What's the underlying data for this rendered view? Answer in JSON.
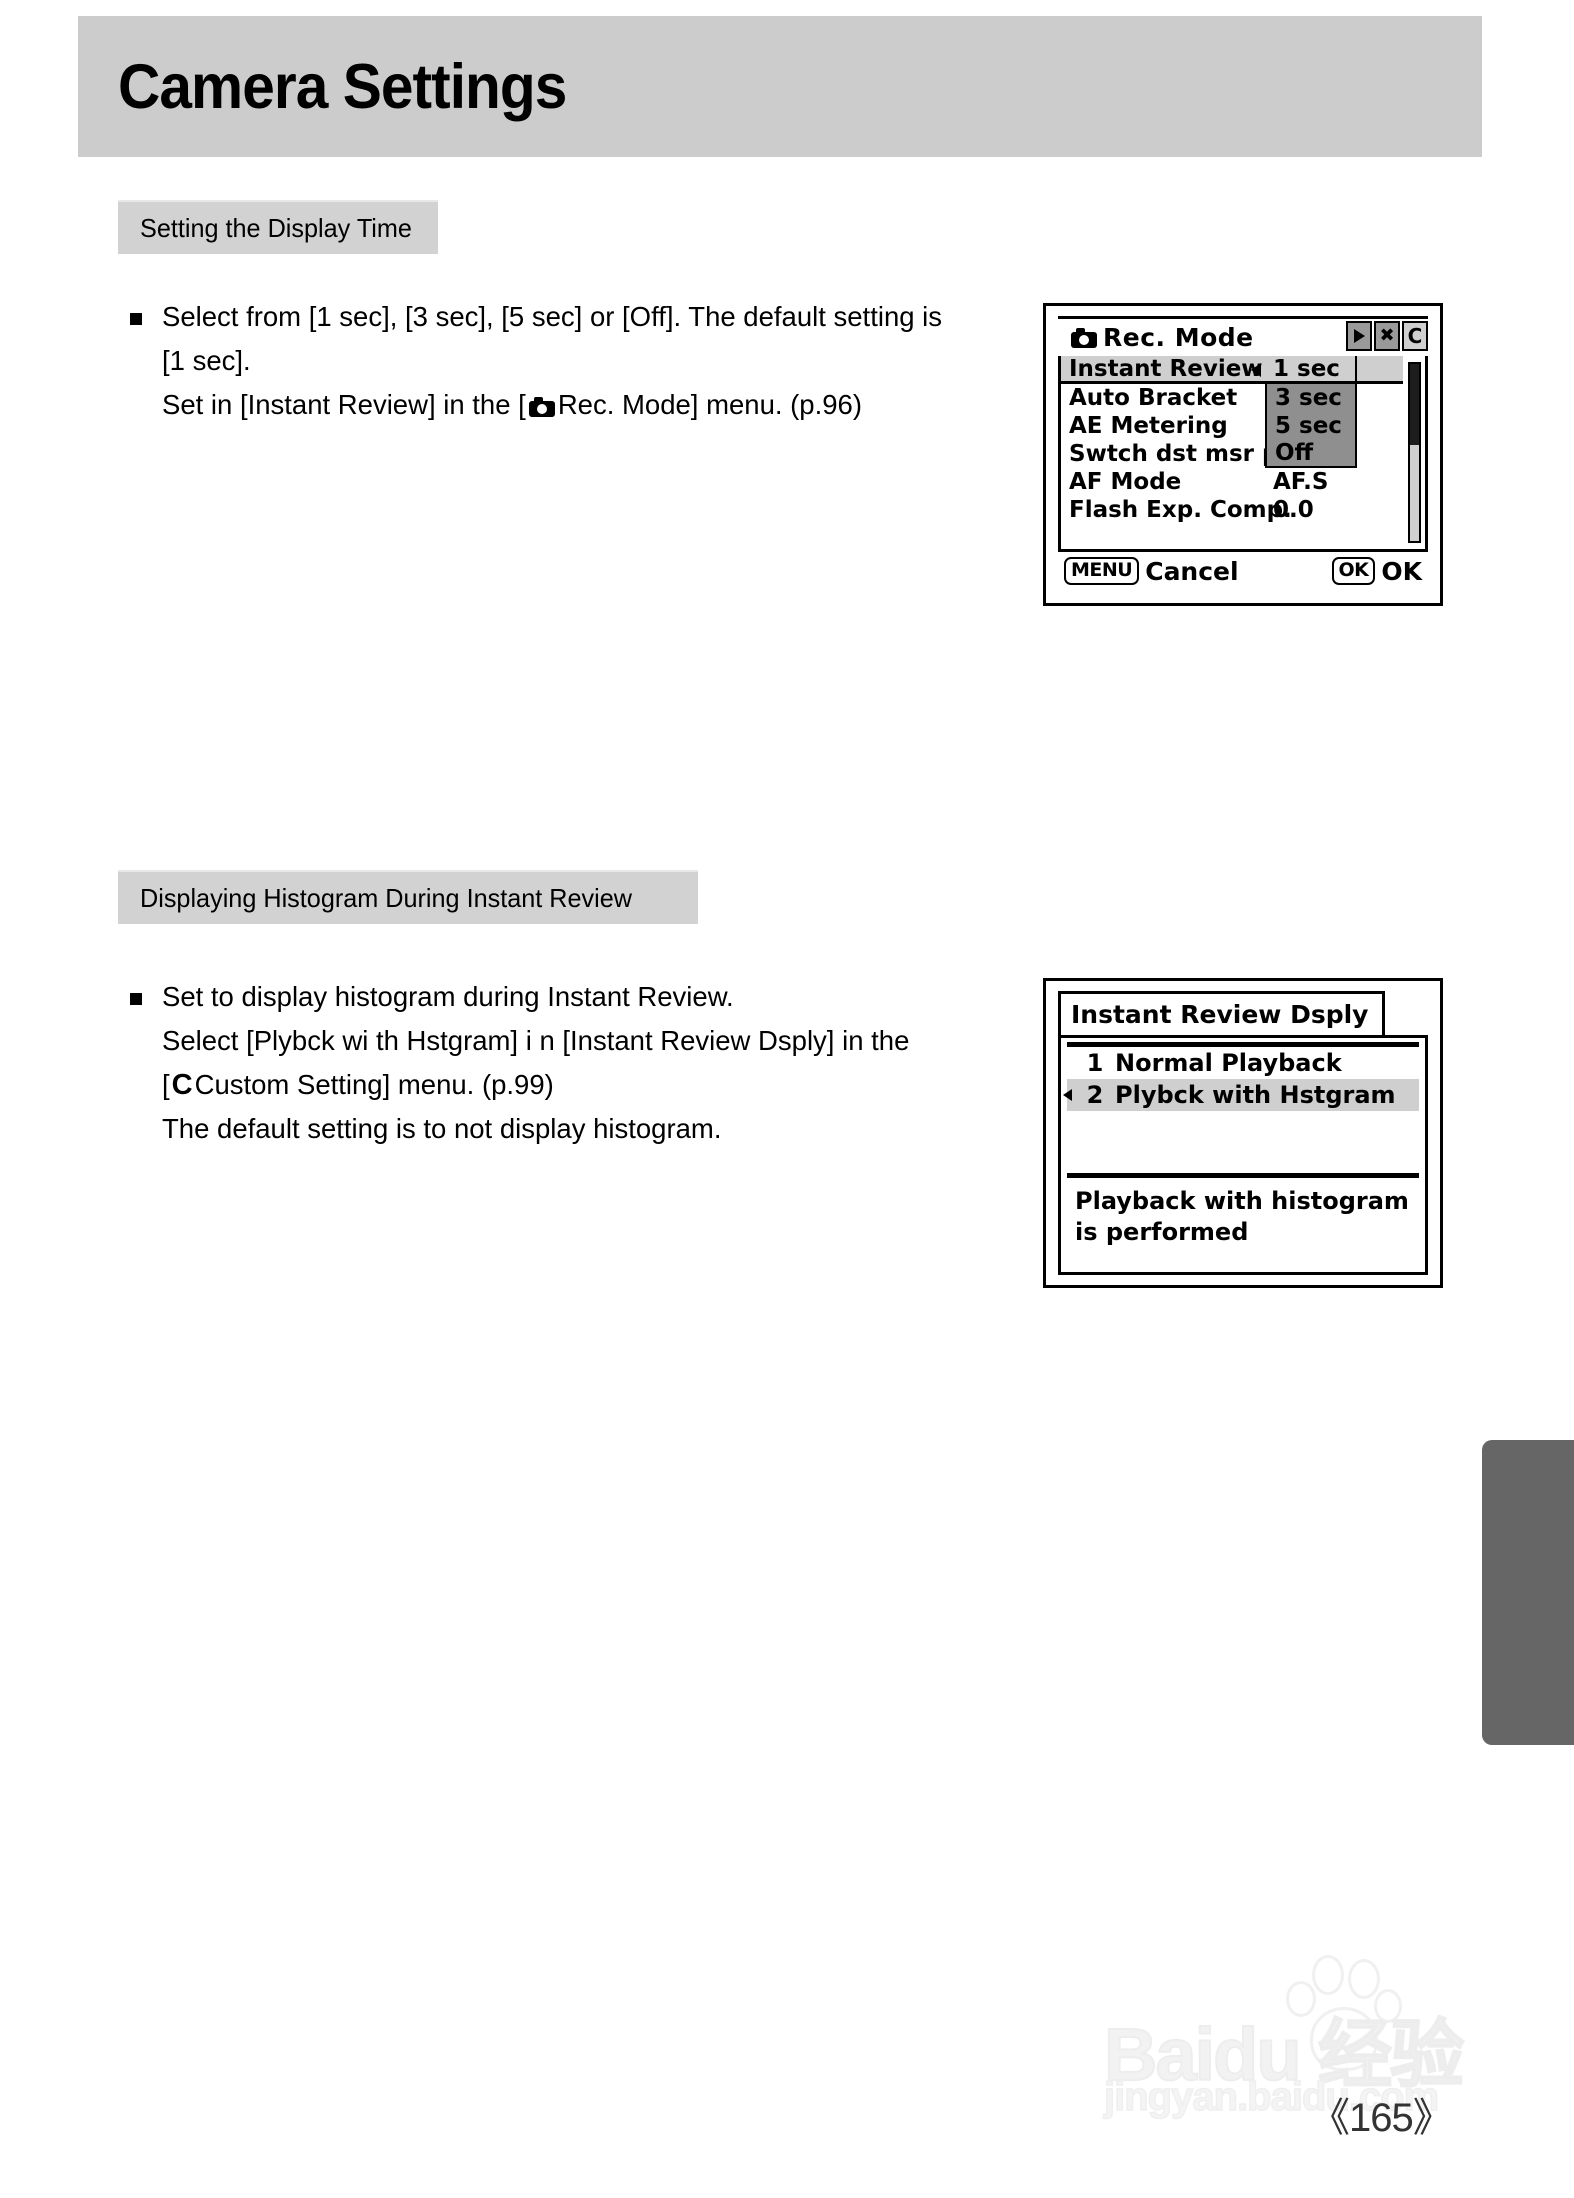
{
  "page": {
    "title": "Camera Settings",
    "page_number": "《165》"
  },
  "watermark": {
    "brand": "Baidu 经验",
    "url": "jingyan.baidu.com"
  },
  "sections": [
    {
      "heading": "Setting the Display Time",
      "body": {
        "line1": "Select from [1 sec], [3 sec], [5 sec] or [Off]. The default setting is",
        "line2": "[1 sec].",
        "line3_a": "Set in [Instant Review] in the [",
        "line3_icon": "camera-icon",
        "line3_b": "Rec. Mode] menu. (p.96)"
      }
    },
    {
      "heading": "Displaying Histogram During Instant Review",
      "body": {
        "line1": "Set to display histogram during Instant Review.",
        "line2": "Select [Plybck wi th Hstgram] i n [Instant Review Dsply] in the",
        "line3_a": "[",
        "line3_icon": "C",
        "line3_b": "Custom Setting] menu. (p.99)",
        "line4": "The default setting is to not display histogram."
      }
    }
  ],
  "lcd_rec_mode": {
    "title": "Rec. Mode",
    "title_icon": "camera-icon",
    "tabs": [
      {
        "name": "playback-tab",
        "glyph": "▶",
        "active": false
      },
      {
        "name": "setup-tab",
        "glyph": "✕",
        "active": false
      },
      {
        "name": "custom-tab",
        "glyph": "C",
        "active": true
      }
    ],
    "rows": [
      {
        "label": "Instant Review",
        "value": "1 sec",
        "selected": true
      },
      {
        "label": "Auto Bracket",
        "value": "",
        "selected": false
      },
      {
        "label": "AE Metering",
        "value": "",
        "selected": false
      },
      {
        "label": "Swtch dst msr pt",
        "value": "",
        "selected": false
      },
      {
        "label": "AF Mode",
        "value": "AF.S",
        "selected": false
      },
      {
        "label": "Flash Exp. Comp.",
        "value": "0.0",
        "selected": false
      }
    ],
    "dropdown": {
      "options": [
        {
          "label": "1 sec",
          "selected": true
        },
        {
          "label": "3 sec",
          "selected": false
        },
        {
          "label": "5 sec",
          "selected": false
        },
        {
          "label": "Off",
          "selected": false
        }
      ]
    },
    "footer": {
      "cancel_key": "MENU",
      "cancel_label": "Cancel",
      "ok_key": "OK",
      "ok_label": "OK"
    }
  },
  "lcd_review_dsply": {
    "title": "Instant Review Dsply",
    "options": [
      {
        "num": "1",
        "label": "Normal Playback",
        "selected": false
      },
      {
        "num": "2",
        "label": "Plybck with Hstgram",
        "selected": true
      }
    ],
    "description_line1": "Playback with histogram",
    "description_line2": "is performed"
  }
}
